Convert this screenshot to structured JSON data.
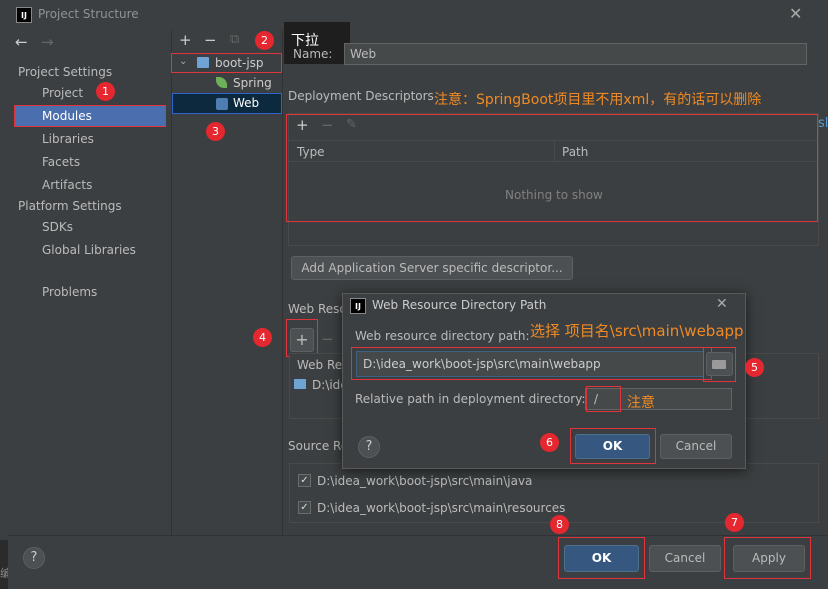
{
  "window": {
    "title": "Project Structure",
    "logo": "IJ"
  },
  "nav": {
    "back": "←",
    "forward": "→"
  },
  "sidebar": {
    "sections": [
      {
        "label": "Project Settings",
        "items": [
          "Project",
          "Modules",
          "Libraries",
          "Facets",
          "Artifacts"
        ]
      },
      {
        "label": "Platform Settings",
        "items": [
          "SDKs",
          "Global Libraries"
        ]
      }
    ],
    "problems": "Problems",
    "selected": "Modules"
  },
  "module_toolbar": {
    "add": "+",
    "remove": "−",
    "copy": "⧉"
  },
  "tree": {
    "root": "boot-jsp",
    "children": [
      "Spring",
      "Web"
    ],
    "selected": "Web"
  },
  "tooltip": {
    "text": "下拉"
  },
  "name_field": {
    "label": "Name:",
    "value": "Web"
  },
  "deployment": {
    "title": "Deployment Descriptors",
    "toolbar": {
      "add": "+",
      "remove": "−",
      "edit": "✎"
    },
    "columns": [
      "Type",
      "Path"
    ],
    "empty": "Nothing to show",
    "add_server_button": "Add Application Server specific descriptor..."
  },
  "web_resource": {
    "title": "Web Reso",
    "toolbar": {
      "add": "+",
      "remove": "−"
    },
    "column": "Web Re",
    "row": "D:\\ide"
  },
  "source_roots": {
    "title": "Source Ro",
    "items": [
      "D:\\idea_work\\boot-jsp\\src\\main\\java",
      "D:\\idea_work\\boot-jsp\\src\\main\\resources"
    ]
  },
  "dialog": {
    "title": "Web Resource Directory Path",
    "path_label": "Web resource directory path:",
    "path_value": "D:\\idea_work\\boot-jsp\\src\\main\\webapp",
    "relative_label": "Relative path in deployment directory:",
    "relative_value": "/",
    "ok": "OK",
    "cancel": "Cancel",
    "help": "?"
  },
  "footer": {
    "help": "?",
    "ok": "OK",
    "cancel": "Cancel",
    "apply": "Apply"
  },
  "annotations": {
    "n1": "1",
    "n2": "2",
    "n3": "3",
    "n4": "4",
    "n5": "5",
    "n6": "6",
    "n7": "7",
    "n8": "8",
    "note_descriptor": "注意：SpringBoot项目里不用xml，有的话可以删除",
    "note_select": "选择 项目名\\src\\main\\webapp",
    "note_relative": "注意"
  },
  "edge": {
    "right_fragment": "sl",
    "bottom_fragment": "编"
  },
  "colors": {
    "accent": "#4b6eaf",
    "primary_button": "#365880",
    "annotation": "#f08a24",
    "marker": "#e5282f"
  }
}
